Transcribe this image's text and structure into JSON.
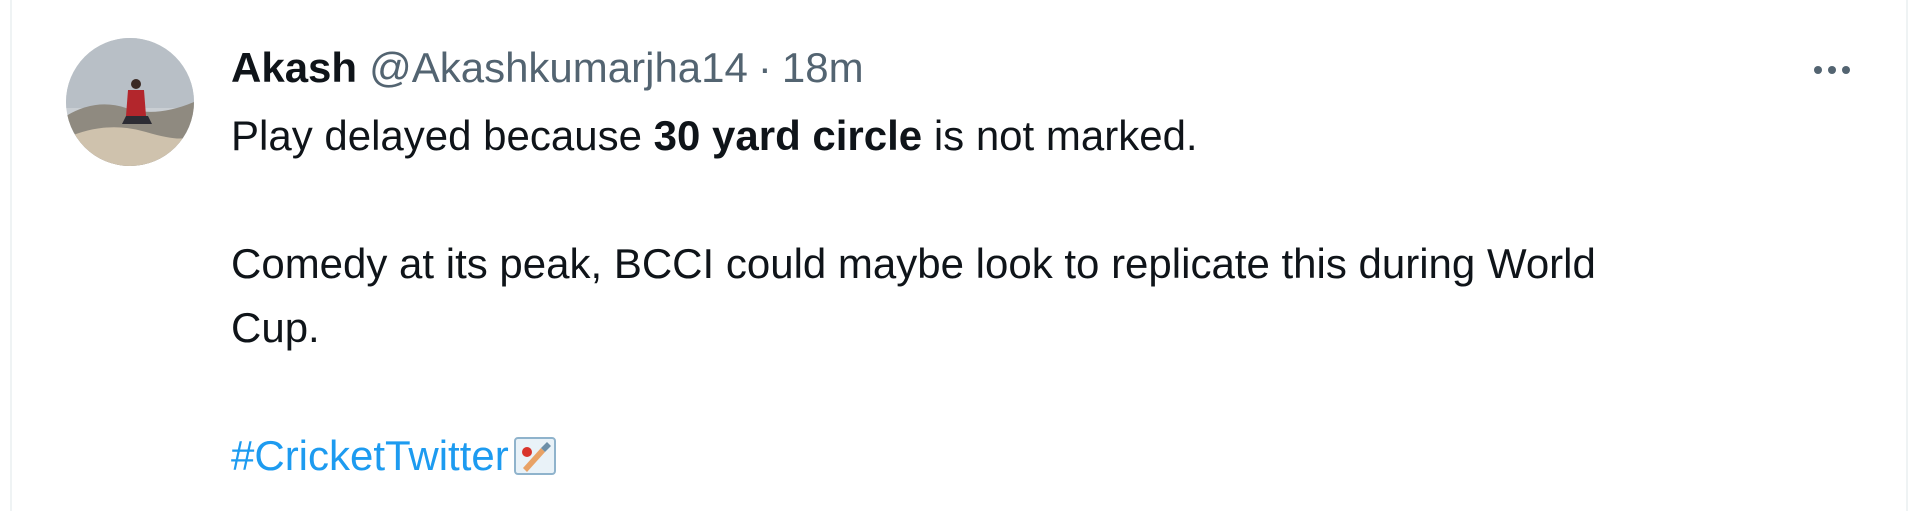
{
  "tweet": {
    "display_name": "Akash",
    "handle": "@Akashkumarjha14",
    "separator": "·",
    "timestamp": "18m",
    "text": {
      "line1_pre": "Play delayed because ",
      "line1_bold": "30 yard circle",
      "line1_post": " is not marked.",
      "line2a": "Comedy at its peak, BCCI could maybe look to replicate this during World",
      "line2b": "Cup.",
      "hashtag": "#CricketTwitter"
    },
    "icons": {
      "more": "more-horizontal-icon",
      "emoji": "cricket-bat-ball-emoji"
    },
    "colors": {
      "text": "#0f1419",
      "secondary": "#536471",
      "link": "#1d9bf0"
    }
  }
}
